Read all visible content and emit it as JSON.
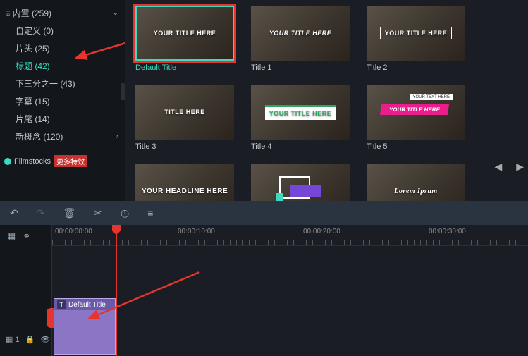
{
  "sidebar": {
    "root": {
      "label": "内置 (259)"
    },
    "items": [
      {
        "label": "自定义 (0)"
      },
      {
        "label": "片头 (25)"
      },
      {
        "label": "标题 (42)",
        "selected": true
      },
      {
        "label": "下三分之一 (43)"
      },
      {
        "label": "字幕 (15)"
      },
      {
        "label": "片尾 (14)"
      },
      {
        "label": "新概念 (120)",
        "expandable": true
      }
    ],
    "filmstocks": {
      "label": "Filmstocks",
      "badge": "更多特效"
    }
  },
  "gallery": {
    "items": [
      {
        "label": "Default Title",
        "title_text": "YOUR TITLE HERE",
        "style": "default",
        "selected": true
      },
      {
        "label": "Title 1",
        "title_text": "YOUR TITLE HERE",
        "style": "italic"
      },
      {
        "label": "Title 2",
        "title_text": "YOUR TITLE HERE",
        "style": "box"
      },
      {
        "label": "Title 3",
        "title_text": "TITLE HERE",
        "style": "lines"
      },
      {
        "label": "Title 4",
        "title_text": "YOUR TITLE HERE",
        "style": "green"
      },
      {
        "label": "Title 5",
        "title_text_a": "YOUR TEXT HERE",
        "title_text_b": "YOUR TITLE HERE",
        "style": "pink"
      },
      {
        "label": "",
        "title_text": "YOUR HEADLINE HERE",
        "style": "headline"
      },
      {
        "label": "",
        "title_text": "",
        "style": "purple"
      },
      {
        "label": "",
        "title_text": "Lorem Ipsum",
        "style": "serif"
      }
    ]
  },
  "toolbar": {
    "undo": "↶",
    "redo": "↷",
    "delete": "🗑",
    "cut": "✂",
    "history": "⟳",
    "adjust": "⚙"
  },
  "timeline": {
    "marks": [
      "00:00:00:00",
      "00:00:10:00",
      "00:00:20:00",
      "00:00:30:00"
    ],
    "clip": {
      "icon": "T",
      "label": "Default Title"
    },
    "track_header": {
      "index": "1",
      "lock": "🔒",
      "eye": "👁"
    }
  },
  "icons": {
    "grid_icon": "⊞",
    "link_icon": "🔗",
    "collapse": "‹"
  }
}
